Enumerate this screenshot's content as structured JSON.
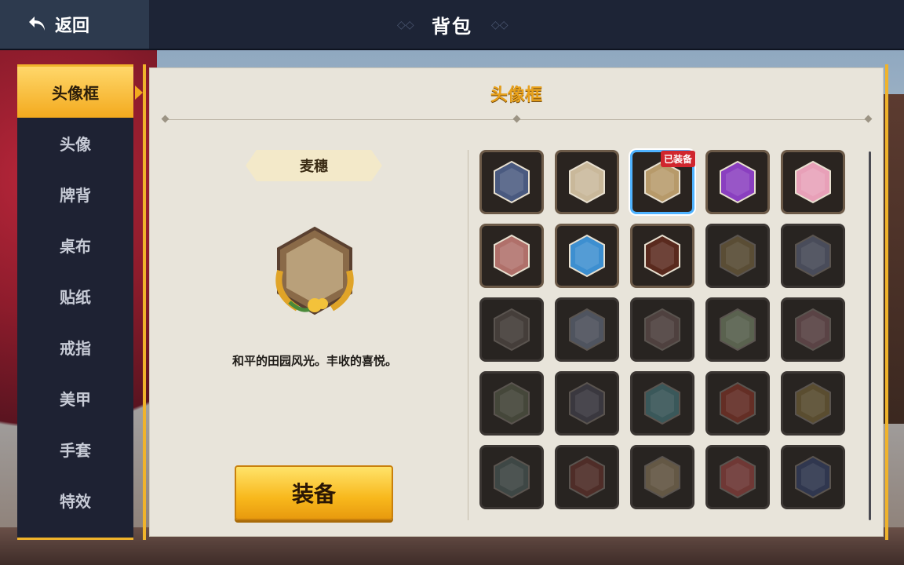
{
  "header": {
    "back_label": "返回",
    "title": "背包"
  },
  "sidebar": {
    "tabs": [
      {
        "label": "头像框",
        "active": true
      },
      {
        "label": "头像",
        "active": false
      },
      {
        "label": "牌背",
        "active": false
      },
      {
        "label": "桌布",
        "active": false
      },
      {
        "label": "贴纸",
        "active": false
      },
      {
        "label": "戒指",
        "active": false
      },
      {
        "label": "美甲",
        "active": false
      },
      {
        "label": "手套",
        "active": false
      },
      {
        "label": "特效",
        "active": false
      }
    ]
  },
  "panel": {
    "title": "头像框",
    "selected_item": {
      "name": "麦穗",
      "description": "和平的田园风光。丰收的喜悦。"
    },
    "equip_label": "装备",
    "equipped_badge": "已装备"
  },
  "grid": [
    {
      "icon": "blue-hexagon-frame-icon",
      "fill": "#4a5a80",
      "owned": true
    },
    {
      "icon": "plain-hexagon-frame-icon",
      "fill": "#c9b89a",
      "owned": true
    },
    {
      "icon": "wheat-frame-icon",
      "fill": "#b79a6a",
      "owned": true,
      "equipped": true
    },
    {
      "icon": "purple-hexagon-frame-icon",
      "fill": "#8a3fc0",
      "owned": true
    },
    {
      "icon": "cat-ear-frame-icon",
      "fill": "#e8a0b8",
      "owned": true
    },
    {
      "icon": "torii-frame-icon",
      "fill": "#b0706a",
      "owned": true
    },
    {
      "icon": "sailor-frame-icon",
      "fill": "#3d8fd0",
      "owned": true
    },
    {
      "icon": "samurai-helmet-frame-icon",
      "fill": "#5a2a1e",
      "owned": true
    },
    {
      "icon": "gold-hexagon-frame-icon",
      "fill": "#6a5a38",
      "owned": false
    },
    {
      "icon": "silver-hexagon-frame-icon",
      "fill": "#505870",
      "owned": false
    },
    {
      "icon": "dark-hexagon-frame-icon",
      "fill": "#4a4240",
      "owned": false
    },
    {
      "icon": "snow-fox-frame-icon",
      "fill": "#5a6478",
      "owned": false
    },
    {
      "icon": "flower-frame-icon",
      "fill": "#5a4848",
      "owned": false
    },
    {
      "icon": "leaf-frame-icon",
      "fill": "#6a7a60",
      "owned": false
    },
    {
      "icon": "sakura-frame-icon",
      "fill": "#6a4a50",
      "owned": false
    },
    {
      "icon": "vine-frame-icon",
      "fill": "#4a5040",
      "owned": false
    },
    {
      "icon": "lucky-cat-frame-icon",
      "fill": "#3a3a48",
      "owned": false
    },
    {
      "icon": "crystal-frame-icon",
      "fill": "#3a6a70",
      "owned": false
    },
    {
      "icon": "crimson-hexagon-frame-icon",
      "fill": "#7a2a20",
      "owned": false
    },
    {
      "icon": "gold-star-frame-icon",
      "fill": "#6a5a30",
      "owned": false
    },
    {
      "icon": "gear-frame-icon",
      "fill": "#405050",
      "owned": false
    },
    {
      "icon": "red-cracked-frame-icon",
      "fill": "#5a2824",
      "owned": false
    },
    {
      "icon": "wooden-frame-icon",
      "fill": "#7a6a50",
      "owned": false
    },
    {
      "icon": "win-ribbon-frame-icon",
      "fill": "#8a3a38",
      "owned": false
    },
    {
      "icon": "constellation-frame-icon",
      "fill": "#2a3860",
      "owned": false
    }
  ]
}
